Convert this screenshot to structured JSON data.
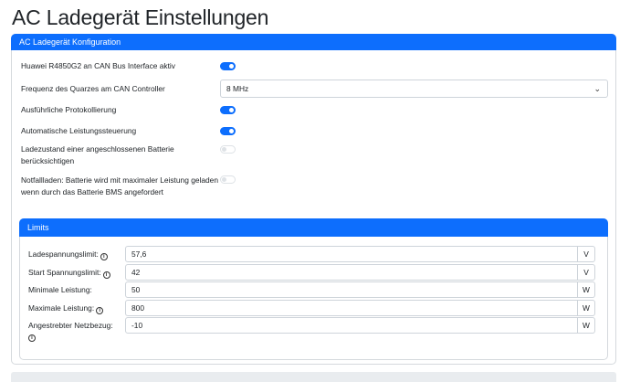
{
  "page": {
    "title": "AC Ladegerät Einstellungen"
  },
  "config_card": {
    "header": "AC Ladegerät Konfiguration",
    "settings": [
      {
        "label": "Huawei R4850G2 an CAN Bus Interface aktiv",
        "enabled": true
      },
      {
        "label": "Ausführliche Protokollierung",
        "enabled": true
      },
      {
        "label": "Automatische Leistungssteuerung",
        "enabled": true
      },
      {
        "label": "Ladezustand einer angeschlossenen Batterie berücksichtigen",
        "enabled": false
      },
      {
        "label": "Notfallladen: Batterie wird mit maximaler Leistung geladen wenn durch das Batterie BMS angefordert",
        "enabled": false
      }
    ],
    "frequency": {
      "label": "Frequenz des Quarzes am CAN Controller",
      "value": "8 MHz"
    }
  },
  "limits_card": {
    "header": "Limits",
    "rows": [
      {
        "label": "Ladespannungslimit:",
        "value": "57,6",
        "unit": "V",
        "info": true
      },
      {
        "label": "Start Spannungslimit:",
        "value": "42",
        "unit": "V",
        "info": true
      },
      {
        "label": "Minimale Leistung:",
        "value": "50",
        "unit": "W",
        "info": false
      },
      {
        "label": "Maximale Leistung:",
        "value": "800",
        "unit": "W",
        "info": true
      },
      {
        "label": "Angestrebter Netzbezug:",
        "value": "-10",
        "unit": "W",
        "info": true
      }
    ]
  },
  "colors": {
    "accent": "#0d6efd",
    "border": "#ced4da"
  }
}
